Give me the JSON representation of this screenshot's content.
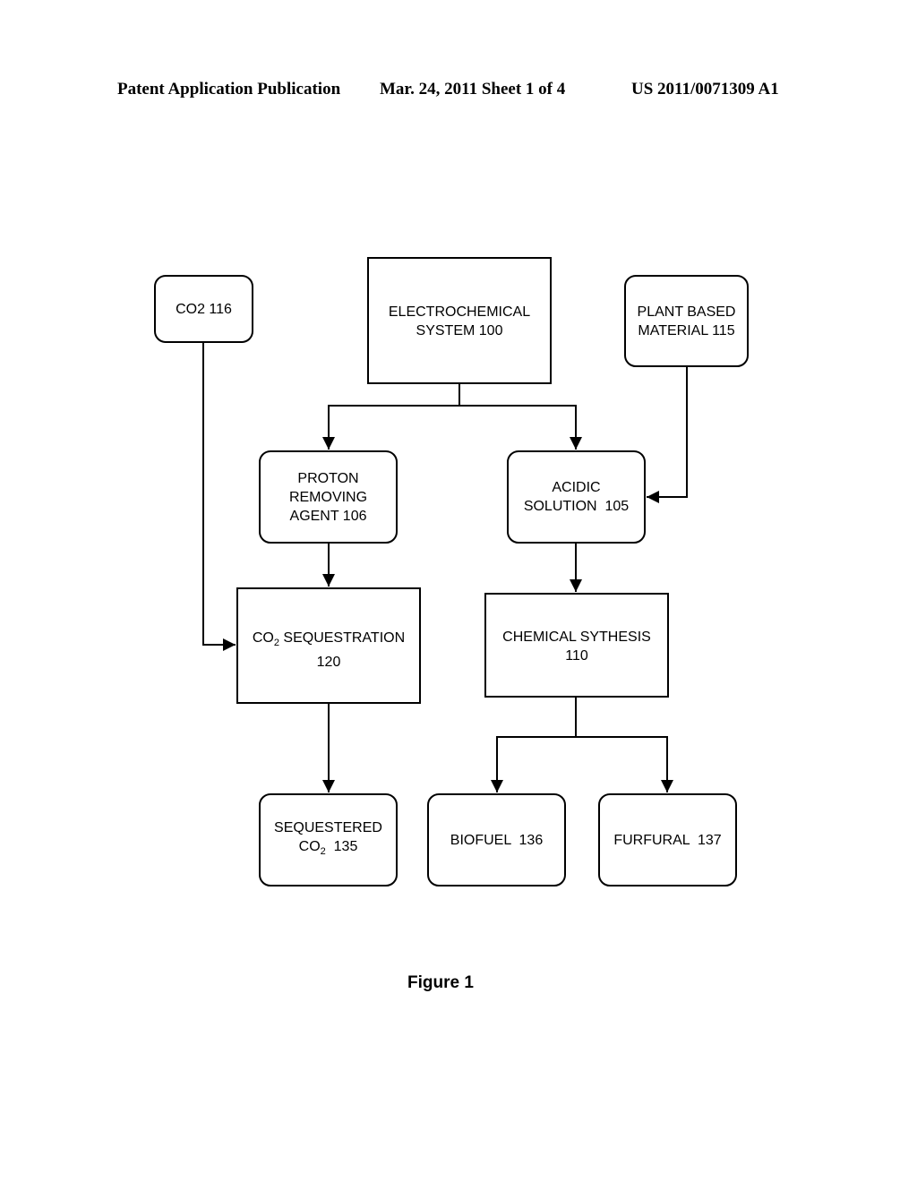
{
  "header": {
    "publication": "Patent Application Publication",
    "date_sheet": "Mar. 24, 2011  Sheet 1 of 4",
    "number": "US 2011/0071309 A1"
  },
  "diagram": {
    "nodes": {
      "co2": {
        "lines": [
          "CO2 116"
        ]
      },
      "electrochemical": {
        "lines": [
          "ELECTROCHEMICAL",
          "SYSTEM 100"
        ]
      },
      "plant": {
        "lines": [
          "PLANT BASED",
          "MATERIAL 115"
        ]
      },
      "proton": {
        "lines": [
          "PROTON",
          "REMOVING",
          "AGENT 106"
        ]
      },
      "acidic": {
        "lines": [
          "ACIDIC",
          "SOLUTION  105"
        ]
      },
      "sequestration": {
        "line1_pre": "CO",
        "line1_sub": "2",
        "line1_post": " SEQUESTRATION",
        "line2": "120"
      },
      "synthesis": {
        "lines": [
          "CHEMICAL SYTHESIS",
          "110"
        ]
      },
      "sequestered": {
        "line1": "SEQUESTERED",
        "line2_pre": "CO",
        "line2_sub": "2",
        "line2_post": "  135"
      },
      "biofuel": {
        "lines": [
          "BIOFUEL  136"
        ]
      },
      "furfural": {
        "lines": [
          "FURFURAL  137"
        ]
      }
    },
    "edges": [
      {
        "from": "electrochemical",
        "to": "proton"
      },
      {
        "from": "electrochemical",
        "to": "acidic"
      },
      {
        "from": "plant",
        "to": "acidic"
      },
      {
        "from": "co2",
        "to": "sequestration"
      },
      {
        "from": "proton",
        "to": "sequestration"
      },
      {
        "from": "acidic",
        "to": "synthesis"
      },
      {
        "from": "sequestration",
        "to": "sequestered"
      },
      {
        "from": "synthesis",
        "to": "biofuel"
      },
      {
        "from": "synthesis",
        "to": "furfural"
      }
    ]
  },
  "caption": "Figure 1"
}
